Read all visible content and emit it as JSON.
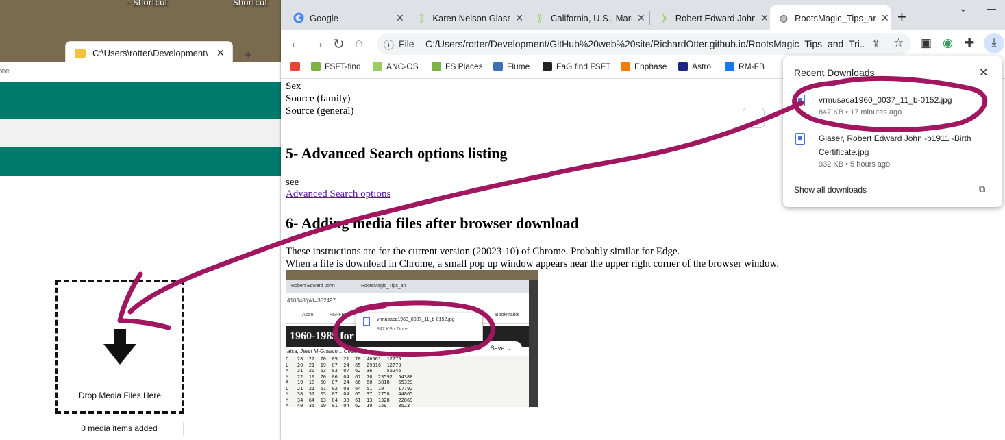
{
  "desktop": {
    "icon_labels": [
      "- Shortcut",
      "Shortcut"
    ]
  },
  "explorer": {
    "tab_title": "C:\\Users\\rotter\\Development\\",
    "close_glyph": "✕",
    "new_tab_glyph": "+"
  },
  "app": {
    "title": "ree",
    "drop_label": "Drop Media Files Here",
    "media_count": "0 media items added"
  },
  "chrome": {
    "tabs": [
      {
        "label": "Google",
        "icon": "google-icon"
      },
      {
        "label": "Karen Nelson Glaser",
        "icon": "ancestry-leaf-icon"
      },
      {
        "label": "California, U.S., Marr",
        "icon": "ancestry-leaf-icon"
      },
      {
        "label": "Robert Edward John",
        "icon": "ancestry-leaf-icon"
      },
      {
        "label": "RootsMagic_Tips_and",
        "icon": "globe-icon"
      }
    ],
    "tab_close_glyph": "✕",
    "new_tab_glyph": "+",
    "window_controls": [
      "⌄",
      "—",
      "☐"
    ],
    "address": {
      "info_glyph": "ⓘ",
      "scheme_label": "File",
      "url": "C:/Users/rotter/Development/GitHub%20web%20site/RichardOtter.github.io/RootsMagic_Tips_and_Tri..."
    },
    "bookmarks": [
      {
        "label": "",
        "color": "#ea4335"
      },
      {
        "label": "FSFT-find",
        "color": "#7cb342"
      },
      {
        "label": "ANC-OS",
        "color": "#9ccc65"
      },
      {
        "label": "FS Places",
        "color": "#7cb342"
      },
      {
        "label": "Flume",
        "color": "#3f6fb5"
      },
      {
        "label": "FaG find FSFT",
        "color": "#222222"
      },
      {
        "label": "Enphase",
        "color": "#f57c00"
      },
      {
        "label": "Astro",
        "color": "#1a237e"
      },
      {
        "label": "RM-FB",
        "color": "#1877f2"
      }
    ]
  },
  "page": {
    "lines_top": [
      "Sex",
      "Source (family)",
      "Source (general)"
    ],
    "heading5": "5- Advanced Search options listing",
    "see": "see",
    "link": "Advanced Search options",
    "heading6": "6- Adding media files after browser download",
    "para1": "These instructions are for the current version (20023-10) of Chrome. Probably similar for Edge.",
    "para2": "When a file is download in Chrome, a small pop up window appears near the upper right corner of the browser window."
  },
  "embedded_shot": {
    "tab1": "Robert Edward John",
    "tab2": "RootsMagic_Tips_an",
    "url_fragment": "410348/pid=382497",
    "bm_items": [
      "Astro",
      "RM-FB"
    ],
    "bm_right": "Bookmarks",
    "popup_file": "vrmusaca1960_0037_11_b-0152.jpg",
    "popup_meta": "847 KB • Done",
    "header_text": "1960-1985 for P",
    "sub_text": "aisa, Jean M-Grisam... Cecelia J",
    "save_label": "Save",
    "table_rows": [
      "C   28  22  70  09  21  70  46561  12779",
      "L   20  21  19  07  24  65  29316  12779",
      "M   31  20  63  03  07  62  36     56245",
      "M   22  19  70  06  04  67  70  23592  54388",
      "A   19  18  60  07  24  66  60  3818   65329",
      "L   21  21  51  02  08  64  51  10     17792",
      "M   38  37  05  07  04  65  37  2750   44865",
      "M   34  64  13  04  38  61  13  1328   22869",
      "A   40  35  19  01  04  62  19  159    3523",
      "J   22  24  30  06  20  66  30  3657   58777"
    ]
  },
  "downloads": {
    "title": "Recent Downloads",
    "close_glyph": "✕",
    "items": [
      {
        "name": "vrmusaca1960_0037_11_b-0152.jpg",
        "meta": "847 KB • 17 minutes ago"
      },
      {
        "name": "Glaser, Robert Edward John -b1911 -Birth Certificate.jpg",
        "meta": "932 KB • 5 hours ago"
      }
    ],
    "show_all": "Show all downloads",
    "open_glyph": "⧉"
  },
  "colors": {
    "annotation_stroke": "#a0175f",
    "app_band": "#007a6b"
  }
}
